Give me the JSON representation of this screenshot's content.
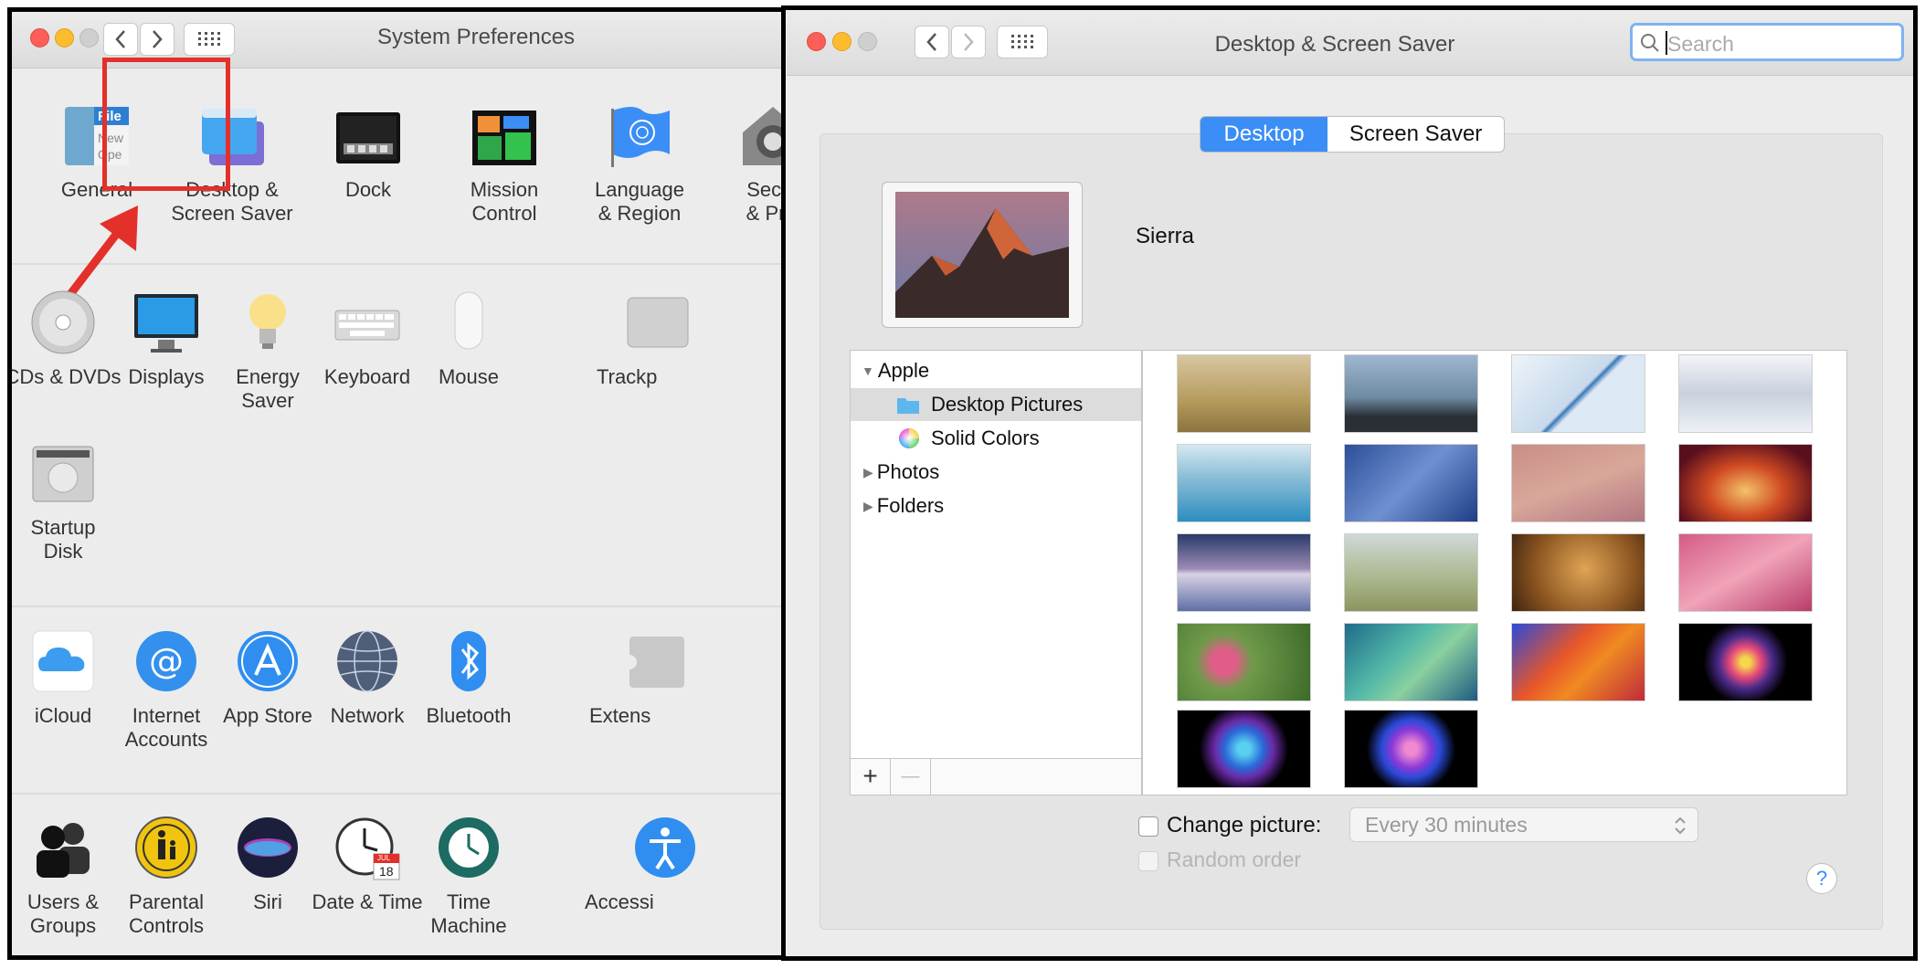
{
  "sysprefs": {
    "title": "System Preferences",
    "rows": [
      [
        {
          "name": "general",
          "label": "General"
        },
        {
          "name": "desktop-screensaver",
          "label": "Desktop &\nScreen Saver"
        },
        {
          "name": "dock",
          "label": "Dock"
        },
        {
          "name": "mission-control",
          "label": "Mission\nControl"
        },
        {
          "name": "language-region",
          "label": "Language\n& Region"
        },
        {
          "name": "security-privacy",
          "label": "Secur\n& Priv"
        }
      ],
      [
        {
          "name": "cds-dvds",
          "label": "CDs & DVDs"
        },
        {
          "name": "displays",
          "label": "Displays"
        },
        {
          "name": "energy-saver",
          "label": "Energy\nSaver"
        },
        {
          "name": "keyboard",
          "label": "Keyboard"
        },
        {
          "name": "mouse",
          "label": "Mouse"
        },
        {
          "name": "trackpad",
          "label": "Trackp"
        }
      ],
      [
        {
          "name": "startup-disk",
          "label": "Startup\nDisk"
        }
      ],
      [
        {
          "name": "icloud",
          "label": "iCloud"
        },
        {
          "name": "internet-accounts",
          "label": "Internet\nAccounts"
        },
        {
          "name": "app-store",
          "label": "App Store"
        },
        {
          "name": "network",
          "label": "Network"
        },
        {
          "name": "bluetooth",
          "label": "Bluetooth"
        },
        {
          "name": "extensions",
          "label": "Extens"
        }
      ],
      [
        {
          "name": "users-groups",
          "label": "Users &\nGroups"
        },
        {
          "name": "parental-controls",
          "label": "Parental\nControls"
        },
        {
          "name": "siri",
          "label": "Siri"
        },
        {
          "name": "date-time",
          "label": "Date & Time"
        },
        {
          "name": "time-machine",
          "label": "Time\nMachine"
        },
        {
          "name": "accessibility",
          "label": "Accessi"
        }
      ]
    ],
    "general_icon_text": [
      "File",
      "New",
      "Ope"
    ],
    "calendar_icon_text": {
      "month": "JUL",
      "day": "18"
    }
  },
  "desktop": {
    "title": "Desktop & Screen Saver",
    "search_placeholder": "Search",
    "tabs": [
      "Desktop",
      "Screen Saver"
    ],
    "active_tab": "Desktop",
    "current_picture_name": "Sierra",
    "sources": [
      {
        "label": "Apple",
        "disclosure": "expanded"
      },
      {
        "label": "Desktop Pictures",
        "selected": true
      },
      {
        "label": "Solid Colors"
      },
      {
        "label": "Photos",
        "disclosure": "collapsed"
      },
      {
        "label": "Folders",
        "disclosure": "collapsed"
      }
    ],
    "add_label": "+",
    "remove_label": "—",
    "change_picture_label": "Change picture:",
    "change_picture_checked": false,
    "interval_value": "Every 30 minutes",
    "random_order_label": "Random order",
    "random_order_enabled": false,
    "help_label": "?",
    "thumbnail_count": 18
  },
  "colors": {
    "accent": "#3b8ef5",
    "highlight": "#e3302a"
  }
}
